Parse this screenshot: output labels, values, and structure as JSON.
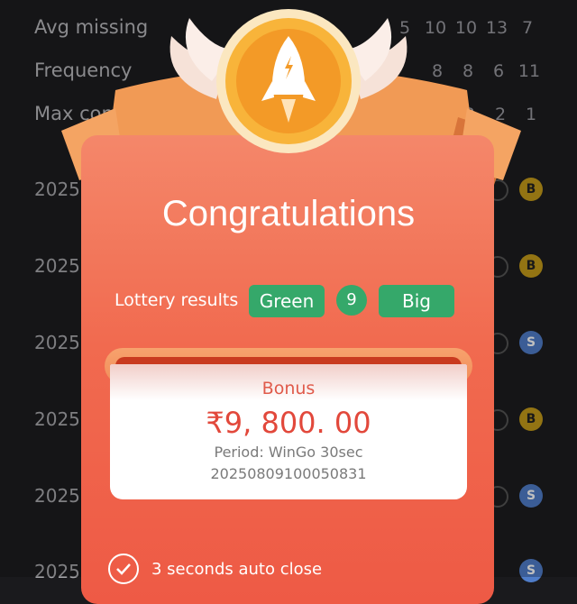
{
  "background": {
    "stats": [
      {
        "label": "Avg missing",
        "values": [
          "5",
          "10",
          "10",
          "13",
          "7"
        ]
      },
      {
        "label": "Frequency",
        "values": [
          "8",
          "8",
          "6",
          "11"
        ]
      },
      {
        "label": "Max cons",
        "values": [
          "2",
          "2",
          "1"
        ]
      }
    ],
    "periods": [
      {
        "text": "2025",
        "result": "B"
      },
      {
        "text": "2025",
        "result": "B"
      },
      {
        "text": "2025",
        "result": "S"
      },
      {
        "text": "2025",
        "result": "B"
      },
      {
        "text": "2025",
        "result": "S"
      },
      {
        "text": "2025",
        "result": "S"
      }
    ]
  },
  "modal": {
    "title": "Congratulations",
    "lottery_label": "Lottery results",
    "result_color": "Green",
    "result_number": "9",
    "result_size": "Big",
    "bonus_label": "Bonus",
    "bonus_amount": "₹9, 800. 00",
    "period_line": "Period: WinGo 30sec",
    "period_id": "20250809100050831",
    "auto_close": "3 seconds auto close"
  },
  "colors": {
    "green": "#35a86a",
    "accent": "#f16a4f",
    "big": "#c49b1a",
    "small": "#4f7dc9"
  },
  "icons": {
    "badge": "rocket-icon",
    "check": "check-icon"
  }
}
